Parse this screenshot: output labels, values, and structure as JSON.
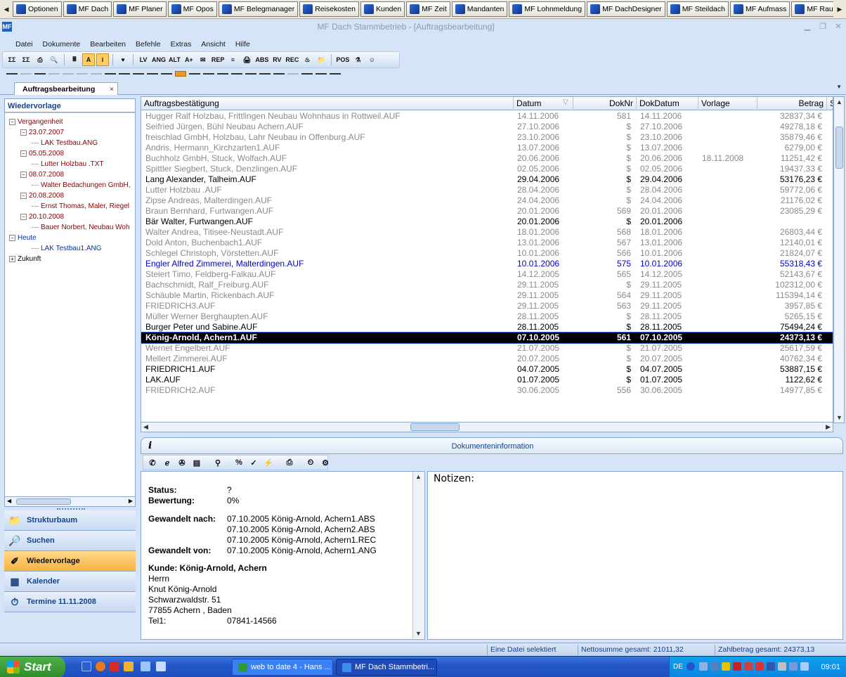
{
  "launcher": [
    "Optionen",
    "MF Dach",
    "MF Planer",
    "MF Opos",
    "MF Belegmanager",
    "Reisekosten",
    "Kunden",
    "MF Zeit",
    "Mandanten",
    "MF Lohnmeldung",
    "MF DachDesigner",
    "MF Steildach",
    "MF Aufmass",
    "MF Raumbuch"
  ],
  "window": {
    "title": "MF Dach   Stammbetrieb - [Auftragsbearbeitung]",
    "logo": "MF"
  },
  "menu": [
    "Datei",
    "Dokumente",
    "Bearbeiten",
    "Befehle",
    "Extras",
    "Ansicht",
    "Hilfe"
  ],
  "toolbar": [
    "ΣΣ",
    "ΣΣ",
    "⎙",
    "🔍",
    "🖩",
    "A",
    "i",
    "♥",
    "LV",
    "ANG",
    "ALT",
    "A+",
    "✉",
    "REP",
    "≡",
    "🖨",
    "ABS",
    "RV",
    "REC",
    "♨",
    "📁",
    "POS",
    "⚗",
    "☺"
  ],
  "doc_tab": {
    "label": "Auftragsbearbeitung",
    "close": "×"
  },
  "sidebar": {
    "header": "Wiedervorlage",
    "tree": [
      {
        "text": "Vergangenheit",
        "cls": "red",
        "expander": "−",
        "indent": 0,
        "row": 0
      },
      {
        "text": "23.07.2007",
        "cls": "red",
        "expander": "−",
        "indent": 1,
        "row": 1
      },
      {
        "text": "LAK Testbau.ANG",
        "cls": "red",
        "expander": "",
        "indent": 2,
        "row": 2
      },
      {
        "text": "05.05.2008",
        "cls": "red",
        "expander": "−",
        "indent": 1,
        "row": 3
      },
      {
        "text": "Lutter Holzbau .TXT",
        "cls": "red",
        "expander": "",
        "indent": 2,
        "row": 4
      },
      {
        "text": "08.07.2008",
        "cls": "red",
        "expander": "−",
        "indent": 1,
        "row": 5
      },
      {
        "text": "Walter Bedachungen GmbH,",
        "cls": "red",
        "expander": "",
        "indent": 2,
        "row": 6
      },
      {
        "text": "20.08.2008",
        "cls": "red",
        "expander": "−",
        "indent": 1,
        "row": 7
      },
      {
        "text": "Ernst  Thomas, Maler, Riegel",
        "cls": "red",
        "expander": "",
        "indent": 2,
        "row": 8
      },
      {
        "text": "20.10.2008",
        "cls": "red",
        "expander": "−",
        "indent": 1,
        "row": 9
      },
      {
        "text": "Bauer Norbert, Neubau Woh",
        "cls": "red",
        "expander": "",
        "indent": 2,
        "row": 10
      },
      {
        "text": "Heute",
        "cls": "blu",
        "expander": "−",
        "indent": 0,
        "row": 11
      },
      {
        "text": "LAK Testbau1.ANG",
        "cls": "blu",
        "expander": "",
        "indent": 2,
        "row": 12
      },
      {
        "text": "Zukunft",
        "cls": "",
        "expander": "+",
        "indent": 0,
        "row": 13
      }
    ],
    "nav": [
      {
        "label": "Strukturbaum",
        "icon": "📁",
        "active": false
      },
      {
        "label": "Suchen",
        "icon": "🔎",
        "active": false
      },
      {
        "label": "Wiedervorlage",
        "icon": "✐",
        "active": true
      },
      {
        "label": "Kalender",
        "icon": "▦",
        "active": false
      },
      {
        "label": "Termine 11.11.2008",
        "icon": "⏱",
        "active": false
      }
    ]
  },
  "grid": {
    "columns": [
      "Auftragsbestätigung",
      "Datum",
      "DokNr",
      "DokDatum",
      "Vorlage",
      "Betrag",
      "S"
    ],
    "sort_indicator": "▽",
    "rows": [
      {
        "c": [
          "Hugger Ralf Holzbau, Frittlingen Neubau Wohnhaus in Rottweil.AUF",
          "14.11.2006",
          "581",
          "14.11.2006",
          "",
          "32837,34 €"
        ],
        "s": "grey"
      },
      {
        "c": [
          "Seifried Jürgen, Bühl Neubau Achern.AUF",
          "27.10.2006",
          "$",
          "27.10.2006",
          "",
          "49278,18 €"
        ],
        "s": "grey"
      },
      {
        "c": [
          "freischlad GmbH, Holzbau, Lahr Neubau in Offenburg.AUF",
          "23.10.2006",
          "$",
          "23.10.2006",
          "",
          "35879,46 €"
        ],
        "s": "grey"
      },
      {
        "c": [
          "Andris, Hermann_Kirchzarten1.AUF",
          "13.07.2006",
          "$",
          "13.07.2006",
          "",
          "6279,00 €"
        ],
        "s": "grey"
      },
      {
        "c": [
          "Buchholz GmbH, Stuck, Wolfach.AUF",
          "20.06.2006",
          "$",
          "20.06.2006",
          "18.11.2008",
          "11251,42 €"
        ],
        "s": "grey"
      },
      {
        "c": [
          "Spittler Siegbert, Stuck, Denzlingen.AUF",
          "02.05.2006",
          "$",
          "02.05.2006",
          "",
          "19437,33 €"
        ],
        "s": "grey"
      },
      {
        "c": [
          "Lang Alexander, Talheim.AUF",
          "29.04.2006",
          "$",
          "29.04.2006",
          "",
          "53176,23 €"
        ],
        "s": "black"
      },
      {
        "c": [
          "Lutter Holzbau .AUF",
          "28.04.2006",
          "$",
          "28.04.2006",
          "",
          "59772,06 €"
        ],
        "s": "grey"
      },
      {
        "c": [
          "Zipse Andreas, Malterdingen.AUF",
          "24.04.2006",
          "$",
          "24.04.2006",
          "",
          "21176,02 €"
        ],
        "s": "grey"
      },
      {
        "c": [
          "Braun Bernhard, Furtwangen.AUF",
          "20.01.2006",
          "569",
          "20.01.2006",
          "",
          "23085,29 €"
        ],
        "s": "grey"
      },
      {
        "c": [
          "Bär Walter, Furtwangen.AUF",
          "20.01.2006",
          "$",
          "20.01.2006",
          "",
          ""
        ],
        "s": "black"
      },
      {
        "c": [
          "Walter Andrea, Titisee-Neustadt.AUF",
          "18.01.2006",
          "568",
          "18.01.2006",
          "",
          "26803,44 €"
        ],
        "s": "grey"
      },
      {
        "c": [
          "Dold Anton, Buchenbach1.AUF",
          "13.01.2006",
          "567",
          "13.01.2006",
          "",
          "12140,01 €"
        ],
        "s": "grey"
      },
      {
        "c": [
          "Schlegel Christoph, Vörstetten.AUF",
          "10.01.2006",
          "566",
          "10.01.2006",
          "",
          "21824,07 €"
        ],
        "s": "grey"
      },
      {
        "c": [
          "Engler Alfred Zimmerei, Malterdingen.AUF",
          "10.01.2006",
          "575",
          "10.01.2006",
          "",
          "55318,43 €"
        ],
        "s": "blue"
      },
      {
        "c": [
          "Steiert Timo, Feldberg-Falkau.AUF",
          "14.12.2005",
          "565",
          "14.12.2005",
          "",
          "52143,67 €"
        ],
        "s": "grey"
      },
      {
        "c": [
          "Bachschmidt, Ralf_Freiburg.AUF",
          "29.11.2005",
          "$",
          "29.11.2005",
          "",
          "102312,00 €"
        ],
        "s": "grey"
      },
      {
        "c": [
          "Schäuble Martin, Rickenbach.AUF",
          "29.11.2005",
          "564",
          "29.11.2005",
          "",
          "115394,14 €"
        ],
        "s": "grey"
      },
      {
        "c": [
          "FRIEDRICH3.AUF",
          "29.11.2005",
          "563",
          "29.11.2005",
          "",
          "3957,85 €"
        ],
        "s": "grey"
      },
      {
        "c": [
          "Müller Werner Berghaupten.AUF",
          "28.11.2005",
          "$",
          "28.11.2005",
          "",
          "5265,15 €"
        ],
        "s": "grey"
      },
      {
        "c": [
          "Burger Peter und Sabine.AUF",
          "28.11.2005",
          "$",
          "28.11.2005",
          "",
          "75494,24 €"
        ],
        "s": "black"
      },
      {
        "c": [
          "König-Arnold, Achern1.AUF",
          "07.10.2005",
          "561",
          "07.10.2005",
          "",
          "24373,13 €"
        ],
        "s": "sel"
      },
      {
        "c": [
          "Wernet Engelbert.AUF",
          "21.07.2005",
          "$",
          "21.07.2005",
          "",
          "25617,59 €"
        ],
        "s": "grey"
      },
      {
        "c": [
          "Mellert Zimmerei.AUF",
          "20.07.2005",
          "$",
          "20.07.2005",
          "",
          "40762,34 €"
        ],
        "s": "grey"
      },
      {
        "c": [
          "FRIEDRICH1.AUF",
          "04.07.2005",
          "$",
          "04.07.2005",
          "",
          "53887,15 €"
        ],
        "s": "black"
      },
      {
        "c": [
          "LAK.AUF",
          "01.07.2005",
          "$",
          "01.07.2005",
          "",
          "1122,62 €"
        ],
        "s": "black"
      },
      {
        "c": [
          "FRIEDRICH2.AUF",
          "30.06.2005",
          "556",
          "30.06.2005",
          "",
          "14977,85 €"
        ],
        "s": "grey"
      }
    ]
  },
  "docinfo": {
    "icon": "i",
    "title": "Dokumenteninformation",
    "toolbar": [
      "✆",
      "ℯ",
      "✇",
      "▤",
      "⚲",
      "%",
      "✓",
      "⚡",
      "⎙",
      "⏲",
      "⚙"
    ],
    "lines": [
      {
        "type": "pair",
        "label": "Status:",
        "value": "?",
        "row": 0
      },
      {
        "type": "pair",
        "label": "Bewertung:",
        "value": "0%",
        "row": 1
      },
      {
        "type": "pair",
        "label": "Gewandelt nach:",
        "value": "07.10.2005 König-Arnold, Achern1.ABS",
        "row": 2.7
      },
      {
        "type": "pair",
        "label": "",
        "value": "07.10.2005 König-Arnold, Achern2.ABS",
        "row": 3.7
      },
      {
        "type": "pair",
        "label": "",
        "value": "07.10.2005 König-Arnold, Achern1.REC",
        "row": 4.7
      },
      {
        "type": "pair",
        "label": "Gewandelt von:",
        "value": "07.10.2005 König-Arnold, Achern1.ANG",
        "row": 5.7
      },
      {
        "type": "bold",
        "text": "Kunde: König-Arnold, Achern",
        "row": 7.4
      },
      {
        "type": "plain",
        "text": "Herrn",
        "row": 8.4
      },
      {
        "type": "plain",
        "text": "Knut König-Arnold",
        "row": 9.4
      },
      {
        "type": "plain",
        "text": "Schwarzwaldstr. 51",
        "row": 10.4
      },
      {
        "type": "plain",
        "text": "77855 Achern , Baden",
        "row": 11.4
      },
      {
        "type": "pair2",
        "label": "Tel1:",
        "value": "07841-14566",
        "row": 12.4
      }
    ],
    "notes_label": "Notizen:"
  },
  "status": {
    "selection": "Eine Datei selektiert",
    "net": "Nettosumme gesamt: 21011,32",
    "pay": "Zahlbetrag gesamt: 24373,13"
  },
  "taskbar": {
    "start": "Start",
    "tasks": [
      {
        "label": "web to date 4 - Hans ...",
        "active": false
      },
      {
        "label": "MF Dach  Stammbetri...",
        "active": true
      }
    ],
    "lang": "DE",
    "clock": "09:01"
  }
}
